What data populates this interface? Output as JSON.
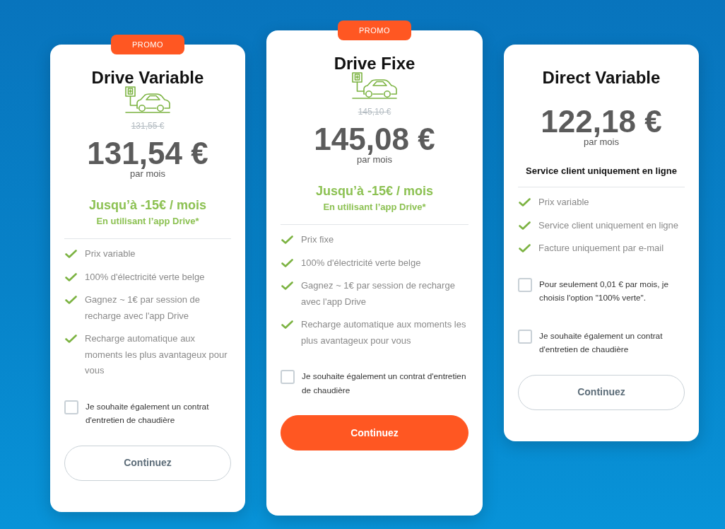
{
  "plans": [
    {
      "badge": "PROMO",
      "featured": false,
      "title": "Drive Variable",
      "illustration": true,
      "old_price": "131,55 €",
      "price": "131,54 €",
      "period": "par mois",
      "offer": {
        "headline": "Jusqu’à -15€ / mois",
        "note": "En utilisant l’app Drive*"
      },
      "features": [
        "Prix variable",
        "100% d'électricité verte belge",
        "Gagnez ~ 1€ par session de recharge avec l'app Drive",
        "Recharge automatique aux moments les plus avantageux pour vous"
      ],
      "options": [
        {
          "label": "Je souhaite également un contrat d'entretien de chaudière",
          "checked": false
        }
      ],
      "button": "Continuez"
    },
    {
      "badge": "PROMO",
      "featured": true,
      "title": "Drive Fixe",
      "illustration": true,
      "old_price": "145,10 €",
      "price": "145,08 €",
      "period": "par mois",
      "offer": {
        "headline": "Jusqu’à -15€ / mois",
        "note": "En utilisant l’app Drive*"
      },
      "features": [
        "Prix fixe",
        "100% d'électricité verte belge",
        "Gagnez ~ 1€ par session de recharge avec l'app Drive",
        "Recharge automatique aux moments les plus avantageux pour vous"
      ],
      "options": [
        {
          "label": "Je souhaite également un contrat d'entretien de chaudière",
          "checked": false
        }
      ],
      "button": "Continuez"
    },
    {
      "featured": false,
      "title": "Direct Variable",
      "illustration": false,
      "price": "122,18 €",
      "period": "par mois",
      "subtitle": "Service client uniquement en ligne",
      "features": [
        "Prix variable",
        "Service client uniquement en ligne",
        "Facture uniquement par e-mail"
      ],
      "options": [
        {
          "label": "Pour seulement 0,01 € par mois, je choisis l'option \"100% verte\".",
          "checked": false
        },
        {
          "label": "Je souhaite également un contrat d'entretien de chaudière",
          "checked": false
        }
      ],
      "button": "Continuez"
    }
  ]
}
